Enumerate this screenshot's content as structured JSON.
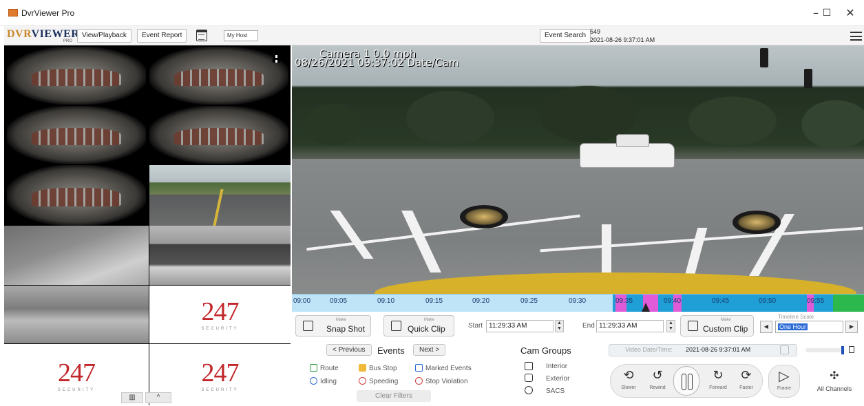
{
  "window": {
    "title": "DvrViewer Pro",
    "minimize_glyph": "–",
    "maximize_glyph": "☐",
    "close_glyph": "✕"
  },
  "toolbar": {
    "logo_part1": "DVR",
    "logo_part2": "VIEWER",
    "logo_sub": "PRO",
    "view_playback": "View/Playback",
    "event_report": "Event Report",
    "selector_value": "My Host",
    "event_search": "Event Search",
    "event_count": "549",
    "event_time": "2021-08-26 9:37:01 AM"
  },
  "camera_grid": {
    "logo_number": "247",
    "logo_text": "SECURITY",
    "bottom_left_glyph": "▥",
    "bottom_right_glyph": "^"
  },
  "video": {
    "osd_line1": "Camera 1    0.0 mph",
    "osd_line2": "08/26/2021 09:37:02  Date/Cam"
  },
  "timeline": {
    "ticks": [
      "09:00",
      "09:05",
      "09:10",
      "09:15",
      "09:20",
      "09:25",
      "09:30",
      "09:35",
      "09:40",
      "09:45",
      "09:50",
      "09:55"
    ],
    "colors": {
      "background": "#bfe4f7",
      "dense": "#1f9fd6",
      "event": "#e05bd8",
      "end": "#2db84d"
    }
  },
  "controls": {
    "snapshot": {
      "make": "Make",
      "label": "Snap Shot"
    },
    "quickclip": {
      "make": "Make",
      "label": "Quick Clip"
    },
    "start_label": "Start",
    "start_value": "11:29:33 AM",
    "end_label": "End",
    "end_value": "11:29:33 AM",
    "customclip": {
      "make": "Make",
      "label": "Custom Clip"
    },
    "timeline_scale_label": "Timeline Scale",
    "timeline_scale_value": "One Hour"
  },
  "events": {
    "previous": "< Previous",
    "title": "Events",
    "next": "Next >",
    "items": [
      "Route",
      "Bus Stop",
      "Marked Events",
      "Idling",
      "Speeding",
      "Stop Violation"
    ],
    "clear_filters": "Clear Filters"
  },
  "cam_groups": {
    "title": "Cam Groups",
    "items": [
      "Interior",
      "Exterior",
      "SACS"
    ]
  },
  "playback": {
    "video_datetime_label": "Video Date/Time:",
    "video_datetime_value": "2021-08-26 9:37:01 AM",
    "slower": "Slower",
    "rewind": "Rewind",
    "forward": "Forward",
    "faster": "Faster",
    "frame": "Frame",
    "all_channels": "All Channels"
  }
}
